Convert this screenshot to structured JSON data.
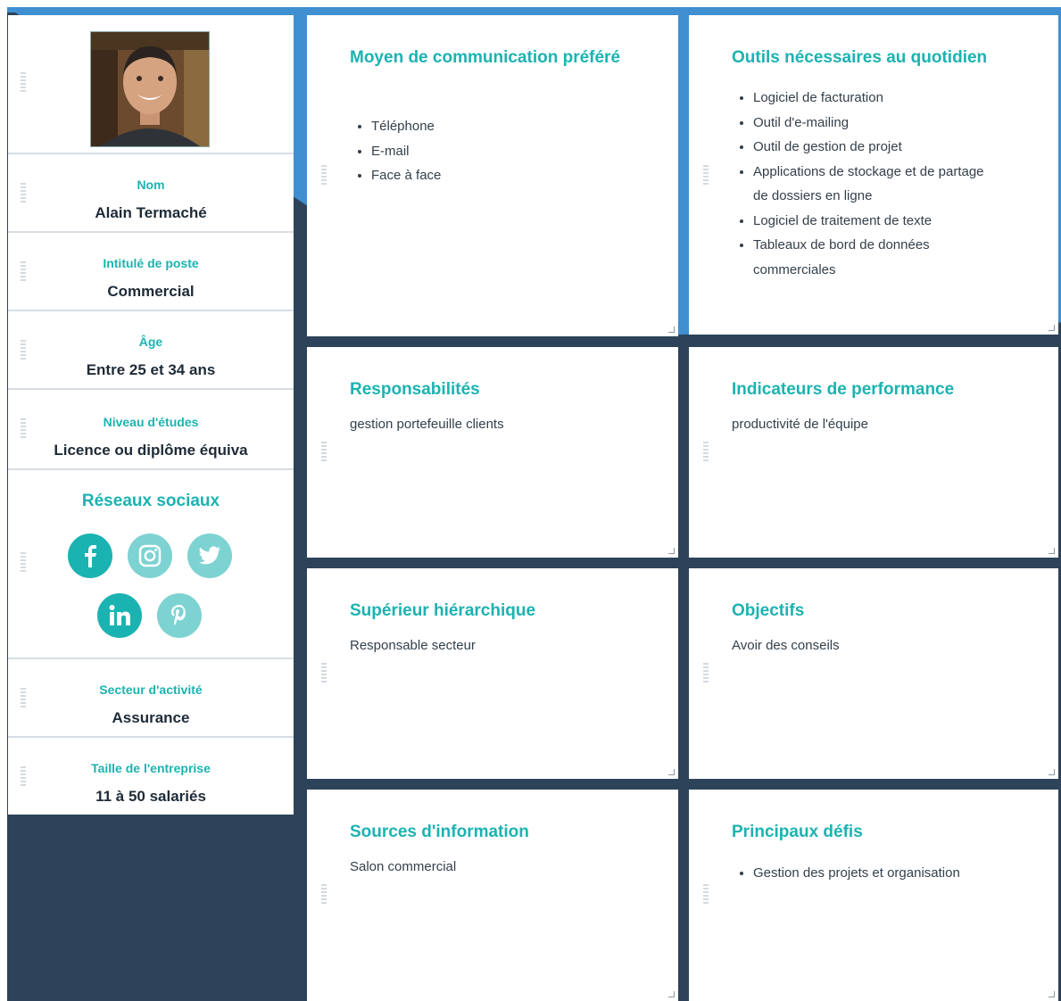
{
  "profile": {
    "name_label": "Nom",
    "name_value": "Alain Termaché",
    "job_label": "Intitulé de poste",
    "job_value": "Commercial",
    "age_label": "Âge",
    "age_value": "Entre 25 et 34 ans",
    "education_label": "Niveau d'études",
    "education_value": "Licence ou diplôme équiva",
    "social_title": "Réseaux sociaux",
    "social_icons": [
      "facebook-icon",
      "instagram-icon",
      "twitter-icon",
      "linkedin-icon",
      "pinterest-icon"
    ],
    "sector_label": "Secteur d'activité",
    "sector_value": "Assurance",
    "company_size_label": "Taille de l'entreprise",
    "company_size_value": "11 à 50 salariés"
  },
  "cards": {
    "communication": {
      "title": "Moyen de communication préféré",
      "items": [
        "Téléphone",
        "E-mail",
        "Face à face"
      ]
    },
    "tools": {
      "title": "Outils nécessaires au quotidien",
      "items": [
        "Logiciel de facturation",
        "Outil d'e-mailing",
        "Outil de gestion de projet",
        "Applications de stockage et de partage de dossiers en ligne",
        "Logiciel de traitement de texte",
        "Tableaux de bord de données commerciales"
      ]
    },
    "responsibilities": {
      "title": "Responsabilités",
      "text": "gestion portefeuille clients"
    },
    "kpi": {
      "title": "Indicateurs de performance",
      "text": "productivité de l'équipe"
    },
    "manager": {
      "title": "Supérieur hiérarchique",
      "text": "Responsable secteur"
    },
    "objectives": {
      "title": "Objectifs",
      "text": "Avoir des conseils"
    },
    "sources": {
      "title": "Sources d'information",
      "text": "Salon commercial"
    },
    "challenges": {
      "title": "Principaux défis",
      "items": [
        "Gestion des projets et organisation"
      ]
    }
  },
  "colors": {
    "accent": "#1bb3b1",
    "accent_light": "#7dd3d2",
    "background_dark": "#2d4359",
    "background_blue": "#3f8fd1"
  }
}
